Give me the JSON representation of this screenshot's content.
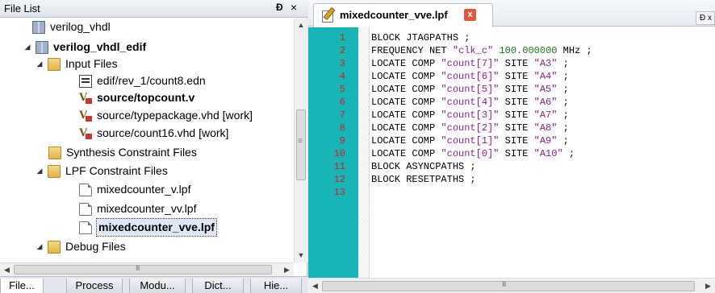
{
  "file_list": {
    "title": "File List",
    "pin_glyph": "Ɖ",
    "close_glyph": "×",
    "tree": [
      {
        "label": "verilog_vhdl",
        "icon": "project-icon",
        "bold": false
      },
      {
        "label": "verilog_vhdl_edif",
        "icon": "project-icon",
        "bold": true,
        "arrow": "◢"
      },
      {
        "label": "Input Files",
        "icon": "folder-icon",
        "bold": false,
        "arrow": "◢"
      },
      {
        "label": "edif/rev_1/count8.edn",
        "icon": "edif-file-icon",
        "bold": false
      },
      {
        "label": "source/topcount.v",
        "icon": "verilog-file-icon",
        "bold": true
      },
      {
        "label": "source/typepackage.vhd [work]",
        "icon": "vhdl-file-icon",
        "bold": false
      },
      {
        "label": "source/count16.vhd [work]",
        "icon": "vhdl-file-icon",
        "bold": false
      },
      {
        "label": "Synthesis Constraint Files",
        "icon": "folder-icon",
        "bold": false
      },
      {
        "label": "LPF Constraint Files",
        "icon": "folder-icon",
        "bold": false,
        "arrow": "◢"
      },
      {
        "label": "mixedcounter_v.lpf",
        "icon": "file-icon",
        "bold": false
      },
      {
        "label": "mixedcounter_vv.lpf",
        "icon": "file-icon",
        "bold": false
      },
      {
        "label": "mixedcounter_vve.lpf",
        "icon": "file-icon",
        "bold": true,
        "selected": true
      },
      {
        "label": "Debug Files",
        "icon": "folder-icon",
        "bold": false,
        "arrow": "◢"
      }
    ],
    "scroll_up": "▲",
    "scroll_down": "▼",
    "scroll_left": "◀",
    "scroll_right": "▶",
    "tabs": [
      "File...",
      "Process",
      "Modu...",
      "Dict...",
      "Hie..."
    ]
  },
  "editor": {
    "tab_label": "mixedcounter_vve.lpf",
    "tab_close": "x",
    "restore_glyph": "Ɖ x",
    "line_numbers": [
      "1",
      "2",
      "3",
      "4",
      "5",
      "6",
      "7",
      "8",
      "9",
      "10",
      "11",
      "12",
      "13"
    ],
    "lines": [
      [
        {
          "t": "BLOCK JTAGPATHS ;",
          "c": "kw"
        }
      ],
      [
        {
          "t": "FREQUENCY NET ",
          "c": "kw"
        },
        {
          "t": "\"clk_c\"",
          "c": "str"
        },
        {
          "t": " ",
          "c": "kw"
        },
        {
          "t": "100.000000",
          "c": "num"
        },
        {
          "t": " MHz ;",
          "c": "kw"
        }
      ],
      [
        {
          "t": "LOCATE COMP ",
          "c": "kw"
        },
        {
          "t": "\"count[7]\"",
          "c": "str"
        },
        {
          "t": " SITE ",
          "c": "kw"
        },
        {
          "t": "\"A3\"",
          "c": "str"
        },
        {
          "t": " ;",
          "c": "kw"
        }
      ],
      [
        {
          "t": "LOCATE COMP ",
          "c": "kw"
        },
        {
          "t": "\"count[6]\"",
          "c": "str"
        },
        {
          "t": " SITE ",
          "c": "kw"
        },
        {
          "t": "\"A4\"",
          "c": "str"
        },
        {
          "t": " ;",
          "c": "kw"
        }
      ],
      [
        {
          "t": "LOCATE COMP ",
          "c": "kw"
        },
        {
          "t": "\"count[5]\"",
          "c": "str"
        },
        {
          "t": " SITE ",
          "c": "kw"
        },
        {
          "t": "\"A5\"",
          "c": "str"
        },
        {
          "t": " ;",
          "c": "kw"
        }
      ],
      [
        {
          "t": "LOCATE COMP ",
          "c": "kw"
        },
        {
          "t": "\"count[4]\"",
          "c": "str"
        },
        {
          "t": " SITE ",
          "c": "kw"
        },
        {
          "t": "\"A6\"",
          "c": "str"
        },
        {
          "t": " ;",
          "c": "kw"
        }
      ],
      [
        {
          "t": "LOCATE COMP ",
          "c": "kw"
        },
        {
          "t": "\"count[3]\"",
          "c": "str"
        },
        {
          "t": " SITE ",
          "c": "kw"
        },
        {
          "t": "\"A7\"",
          "c": "str"
        },
        {
          "t": " ;",
          "c": "kw"
        }
      ],
      [
        {
          "t": "LOCATE COMP ",
          "c": "kw"
        },
        {
          "t": "\"count[2]\"",
          "c": "str"
        },
        {
          "t": " SITE ",
          "c": "kw"
        },
        {
          "t": "\"A8\"",
          "c": "str"
        },
        {
          "t": " ;",
          "c": "kw"
        }
      ],
      [
        {
          "t": "LOCATE COMP ",
          "c": "kw"
        },
        {
          "t": "\"count[1]\"",
          "c": "str"
        },
        {
          "t": " SITE ",
          "c": "kw"
        },
        {
          "t": "\"A9\"",
          "c": "str"
        },
        {
          "t": " ;",
          "c": "kw"
        }
      ],
      [
        {
          "t": "LOCATE COMP ",
          "c": "kw"
        },
        {
          "t": "\"count[0]\"",
          "c": "str"
        },
        {
          "t": " SITE ",
          "c": "kw"
        },
        {
          "t": "\"A10\"",
          "c": "str"
        },
        {
          "t": " ;",
          "c": "kw"
        }
      ],
      [
        {
          "t": "BLOCK ASYNCPATHS ;",
          "c": "kw"
        }
      ],
      [
        {
          "t": "BLOCK RESETPATHS ;",
          "c": "kw"
        }
      ],
      []
    ],
    "colors": {
      "gutter": "#17b5b5",
      "line_number": "#d21f1f",
      "string": "#8b1e8b",
      "number": "#1a7b1a"
    }
  }
}
